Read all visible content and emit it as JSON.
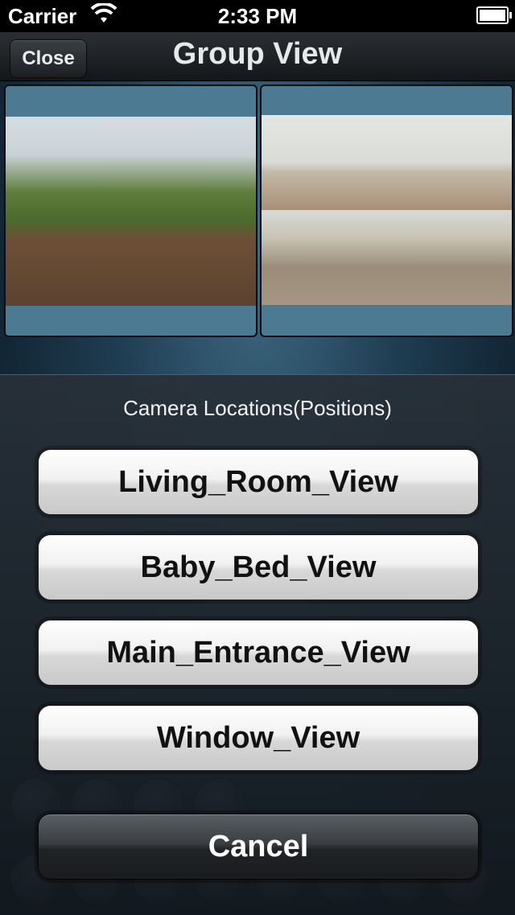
{
  "status_bar": {
    "carrier": "Carrier",
    "time": "2:33 PM",
    "wifi_icon": "wifi-icon",
    "battery_icon": "battery-icon"
  },
  "nav": {
    "title": "Group View",
    "close_label": "Close"
  },
  "cameras": [
    {
      "name": "camera-tile-left"
    },
    {
      "name": "camera-tile-right"
    }
  ],
  "action_sheet": {
    "title": "Camera Locations(Positions)",
    "options": [
      "Living_Room_View",
      "Baby_Bed_View",
      "Main_Entrance_View",
      "Window_View"
    ],
    "cancel_label": "Cancel"
  }
}
